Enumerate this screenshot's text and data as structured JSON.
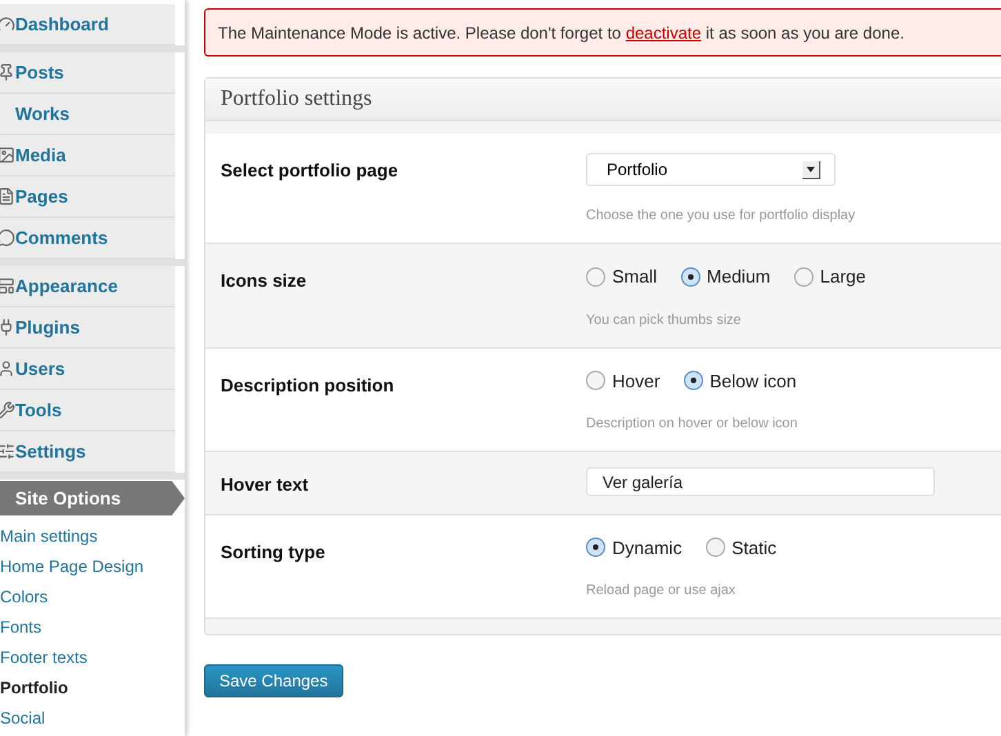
{
  "sidebar": {
    "menu_groups": [
      [
        {
          "label": "Dashboard"
        }
      ],
      [
        {
          "label": "Posts"
        },
        {
          "label": "Works"
        },
        {
          "label": "Media"
        },
        {
          "label": "Pages"
        },
        {
          "label": "Comments"
        }
      ],
      [
        {
          "label": "Appearance"
        },
        {
          "label": "Plugins"
        },
        {
          "label": "Users"
        },
        {
          "label": "Tools"
        },
        {
          "label": "Settings"
        }
      ]
    ],
    "active_menu": {
      "label": "Site Options"
    },
    "submenu": [
      {
        "label": "Main settings",
        "selected": false
      },
      {
        "label": "Home Page Design",
        "selected": false
      },
      {
        "label": "Colors",
        "selected": false
      },
      {
        "label": "Fonts",
        "selected": false
      },
      {
        "label": "Footer texts",
        "selected": false
      },
      {
        "label": "Portfolio",
        "selected": true
      },
      {
        "label": "Social",
        "selected": false
      }
    ]
  },
  "notice": {
    "before": "The Maintenance Mode is active. Please don't forget to",
    "link": "deactivate",
    "after": "it as soon as you are done."
  },
  "panel": {
    "title": "Portfolio settings",
    "rows": [
      {
        "kind": "select",
        "label": "Select portfolio page",
        "value": "Portfolio",
        "help": "Choose the one you use for portfolio display"
      },
      {
        "kind": "radio",
        "label": "Icons size",
        "options": [
          {
            "label": "Small",
            "selected": false
          },
          {
            "label": "Medium",
            "selected": true
          },
          {
            "label": "Large",
            "selected": false
          }
        ],
        "help": "You can pick thumbs size"
      },
      {
        "kind": "radio",
        "label": "Description position",
        "options": [
          {
            "label": "Hover",
            "selected": false
          },
          {
            "label": "Below icon",
            "selected": true
          }
        ],
        "help": "Description on hover or below icon"
      },
      {
        "kind": "text",
        "label": "Hover text",
        "value": "Ver galería"
      },
      {
        "kind": "radio",
        "label": "Sorting type",
        "options": [
          {
            "label": "Dynamic",
            "selected": true
          },
          {
            "label": "Static",
            "selected": false
          }
        ],
        "help": "Reload page or use ajax"
      }
    ]
  },
  "save_button": "Save Changes"
}
